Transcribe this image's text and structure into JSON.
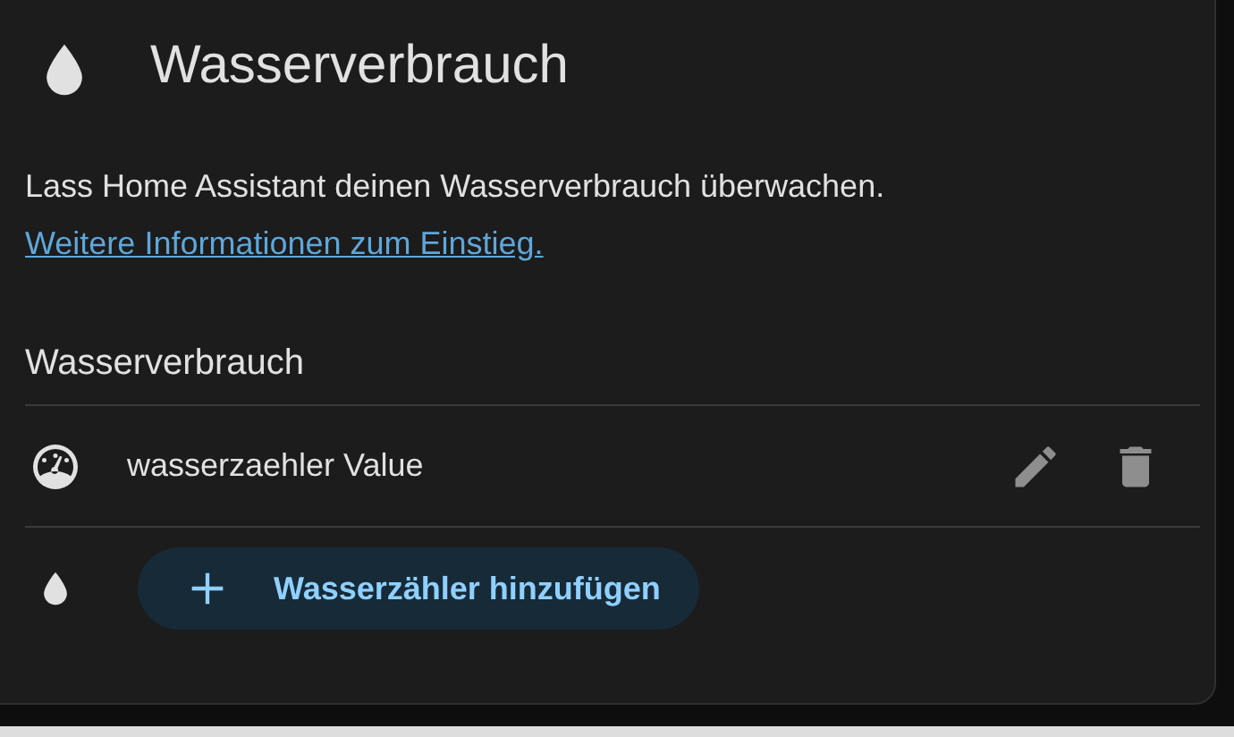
{
  "title": "Wasserverbrauch",
  "description": {
    "text": "Lass Home Assistant deinen Wasserverbrauch überwachen.",
    "link": "Weitere Informationen zum Einstieg."
  },
  "section_title": "Wasserverbrauch",
  "sources": [
    {
      "name": "wasserzaehler Value"
    }
  ],
  "add_button": "Wasserzähler hinzufügen"
}
